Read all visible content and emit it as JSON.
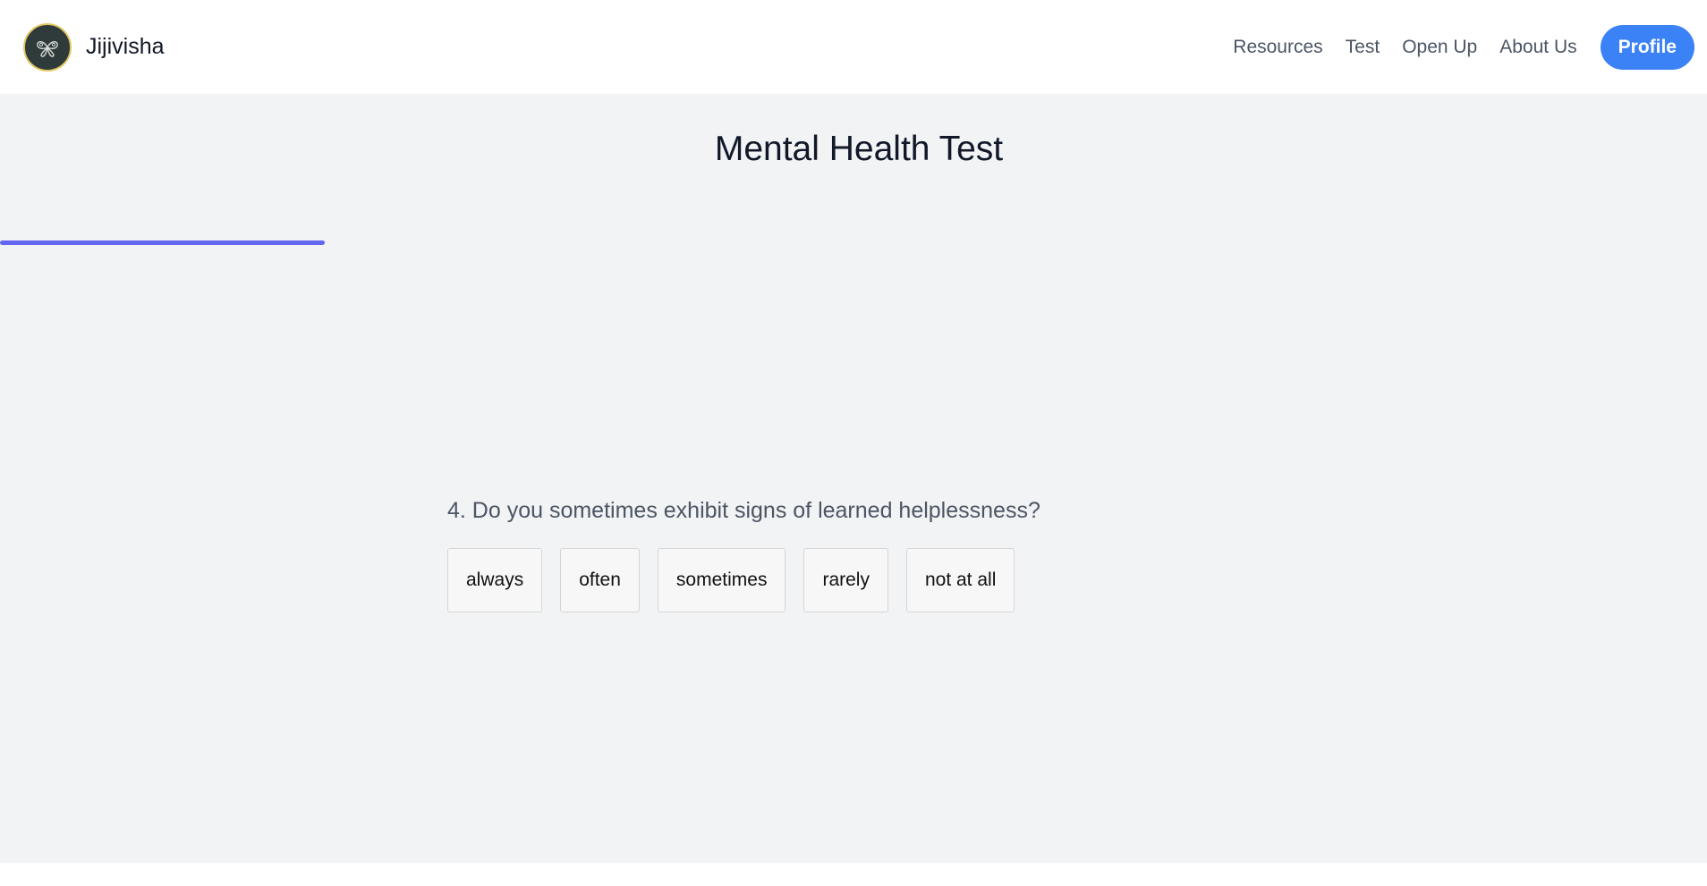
{
  "header": {
    "brand": "Jijivisha",
    "logo_icon": "butterfly-icon",
    "nav": [
      "Resources",
      "Test",
      "Open Up",
      "About Us"
    ],
    "profile_label": "Profile"
  },
  "main": {
    "title": "Mental Health Test",
    "progress_fraction": 0.19,
    "question": "4. Do you sometimes exhibit signs of learned helplessness?",
    "options": [
      "always",
      "often",
      "sometimes",
      "rarely",
      "not at all"
    ]
  },
  "colors": {
    "accent": "#3b82f6",
    "progress": "#6366f1",
    "background": "#f2f3f5",
    "logo_bg": "#2f3b3a",
    "logo_ring": "#e2c766"
  }
}
